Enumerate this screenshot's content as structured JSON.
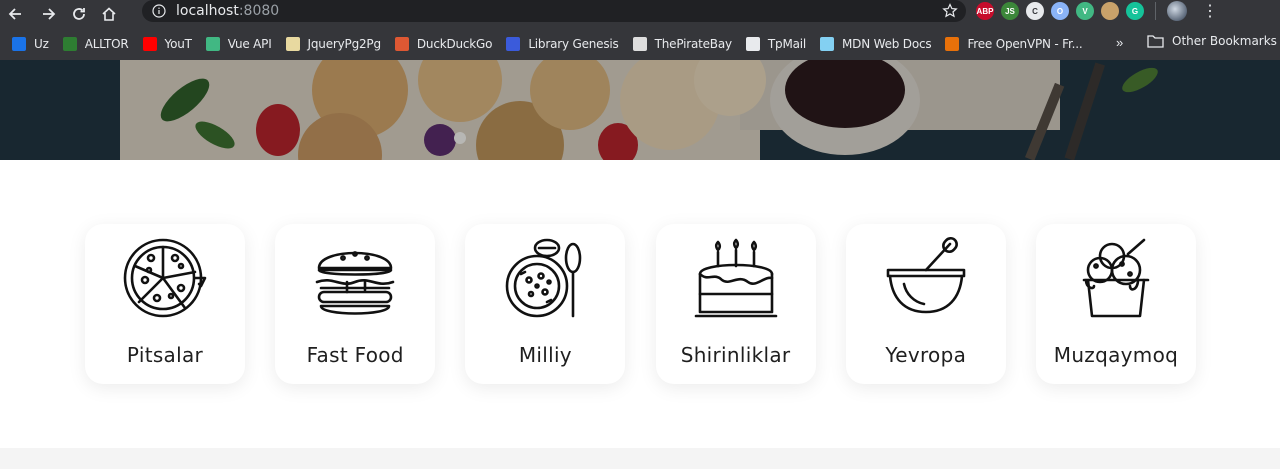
{
  "browser": {
    "url_host": "localhost",
    "url_port": ":8080",
    "bookmarks": [
      {
        "label": "Uz",
        "icon": "uz-icon",
        "color": "#1a73e8"
      },
      {
        "label": "ALLTOR",
        "icon": "alltor-icon",
        "color": "#2e7d32"
      },
      {
        "label": "YouT",
        "icon": "youtube-icon",
        "color": "#ff0000"
      },
      {
        "label": "Vue API",
        "icon": "vue-icon",
        "color": "#41b883"
      },
      {
        "label": "JqueryPg2Pg",
        "icon": "jquery-icon",
        "color": "#e8d9a0"
      },
      {
        "label": "DuckDuckGo",
        "icon": "duckduckgo-icon",
        "color": "#de5833"
      },
      {
        "label": "Library Genesis",
        "icon": "libgen-icon",
        "color": "#3b5bdb"
      },
      {
        "label": "ThePirateBay",
        "icon": "piratebay-icon",
        "color": "#dddddd"
      },
      {
        "label": "TpMail",
        "icon": "globe-icon",
        "color": "#e8eaed"
      },
      {
        "label": "MDN Web Docs",
        "icon": "mdn-icon",
        "color": "#83d0f2"
      },
      {
        "label": "Free OpenVPN - Fr...",
        "icon": "openvpn-icon",
        "color": "#e8710a"
      }
    ],
    "more_label": "»",
    "other_bookmarks": "Other Bookmarks",
    "extensions": [
      {
        "name": "adblock-plus-icon",
        "text": "ABP",
        "color": "#c70d2c"
      },
      {
        "name": "nodejs-icon",
        "text": "JS",
        "color": "#3c873a"
      },
      {
        "name": "extension-c-icon",
        "text": "C",
        "color": "#e8eaed"
      },
      {
        "name": "extension-o-icon",
        "text": "O",
        "color": "#8ab4f8"
      },
      {
        "name": "vue-devtools-icon",
        "text": "V",
        "color": "#41b883"
      },
      {
        "name": "extension-face-icon",
        "text": "",
        "color": "#c9a26a"
      },
      {
        "name": "grammarly-icon",
        "text": "G",
        "color": "#15c39a"
      }
    ]
  },
  "categories": [
    {
      "label": "Pitsalar",
      "icon": "pizza-icon"
    },
    {
      "label": "Fast Food",
      "icon": "burger-icon"
    },
    {
      "label": "Milliy",
      "icon": "national-dish-icon"
    },
    {
      "label": "Shirinliklar",
      "icon": "cake-icon"
    },
    {
      "label": "Yevropa",
      "icon": "mortar-bowl-icon"
    },
    {
      "label": "Muzqaymoq",
      "icon": "ice-cream-icon"
    }
  ]
}
